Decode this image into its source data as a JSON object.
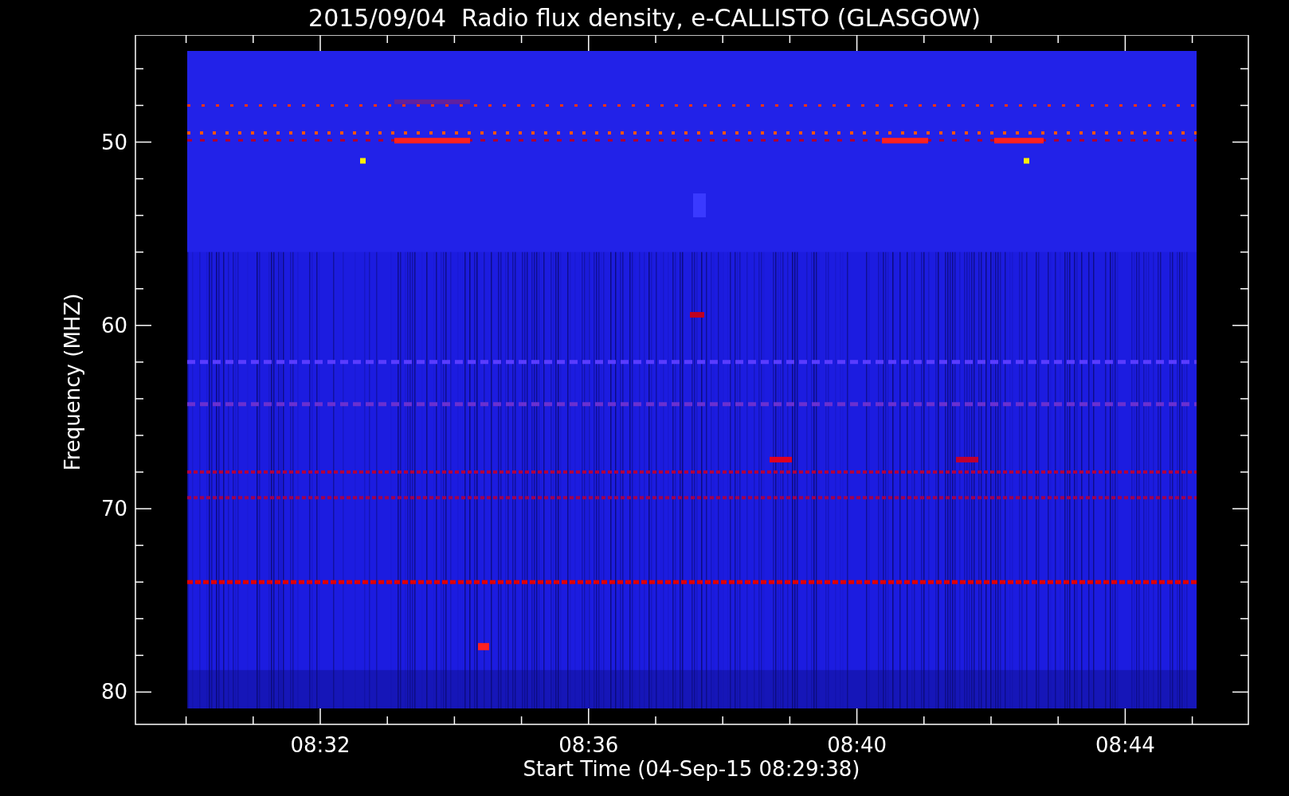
{
  "title": "2015/09/04  Radio flux density, e-CALLISTO (GLASGOW)",
  "plot": {
    "ylabel": "Frequency (MHZ)",
    "xlabel": "Start Time (04-Sep-15 08:29:38)",
    "yticks": [
      "50",
      "60",
      "70",
      "80"
    ],
    "xticks": [
      "08:32",
      "08:36",
      "08:40",
      "08:44"
    ]
  }
}
